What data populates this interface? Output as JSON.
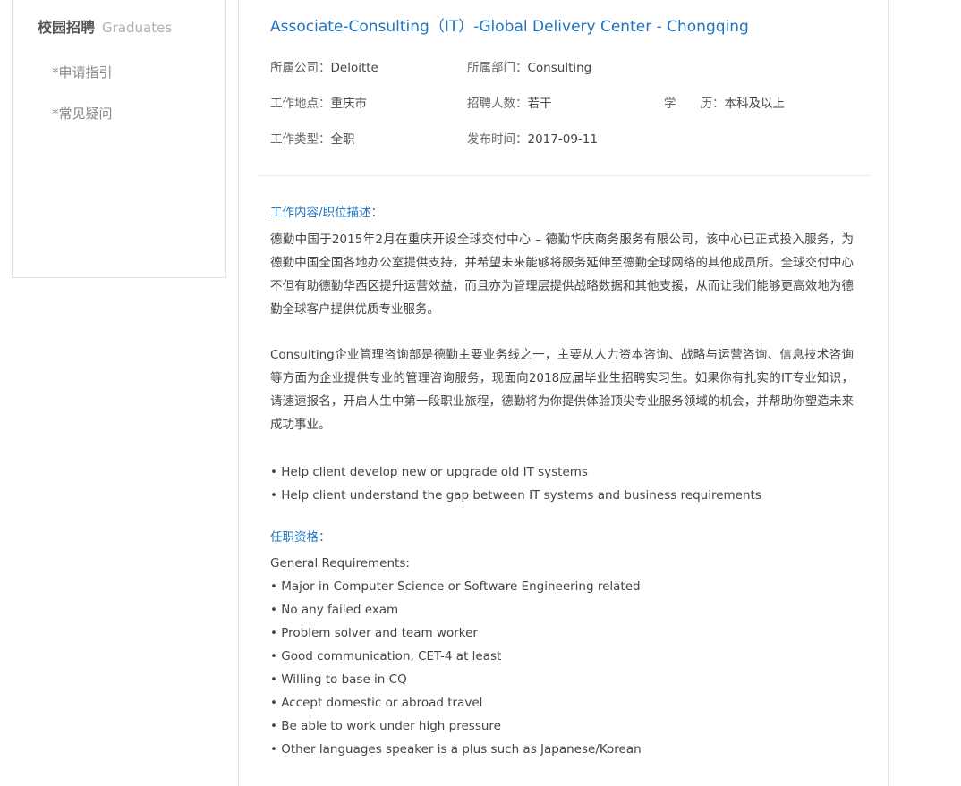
{
  "sidebar": {
    "title": "校园招聘",
    "subtitle": "Graduates",
    "links": [
      "*申请指引",
      "*常见疑问"
    ]
  },
  "job": {
    "title": "Associate-Consulting（IT）-Global Delivery Center - Chongqing",
    "company_label": "所属公司：",
    "company": "Deloitte",
    "department_label": "所属部门：",
    "department": "Consulting",
    "location_label": "工作地点：",
    "location": "重庆市",
    "headcount_label": "招聘人数：",
    "headcount": "若干",
    "education_label": "学　　历：",
    "education": "本科及以上",
    "type_label": "工作类型：",
    "type": "全职",
    "publish_label": "发布时间：",
    "publish_date": "2017-09-11"
  },
  "description": {
    "heading": "工作内容/职位描述：",
    "para1": "德勤中国于2015年2月在重庆开设全球交付中心 – 德勤华庆商务服务有限公司，该中心已正式投入服务，为德勤中国全国各地办公室提供支持，并希望未来能够将服务延伸至德勤全球网络的其他成员所。全球交付中心不但有助德勤华西区提升运营效益，而且亦为管理层提供战略数据和其他支援，从而让我们能够更高效地为德勤全球客户提供优质专业服务。",
    "para2": "Consulting企业管理咨询部是德勤主要业务线之一，主要从人力资本咨询、战略与运营咨询、信息技术咨询等方面为企业提供专业的管理咨询服务，现面向2018应届毕业生招聘实习生。如果你有扎实的IT专业知识，请速速报名，开启人生中第一段职业旅程，德勤将为你提供体验顶尖专业服务领域的机会，并帮助你塑造未来成功事业。",
    "bullets": [
      "• Help client develop new or upgrade old IT systems",
      "• Help client understand the gap between IT systems and business requirements"
    ]
  },
  "requirements": {
    "heading": "任职资格：",
    "intro": "General Requirements:",
    "bullets": [
      "• Major in Computer Science or Software Engineering related",
      "• No any failed exam",
      "• Problem solver and team worker",
      "• Good communication, CET-4 at least",
      "• Willing to base in CQ",
      "• Accept domestic or abroad travel",
      "• Be able to work under high pressure",
      "• Other languages speaker is a plus such as Japanese/Korean"
    ]
  },
  "colors": {
    "accent": "#1f74c0",
    "text": "#444444",
    "border": "#e3e3e3"
  }
}
